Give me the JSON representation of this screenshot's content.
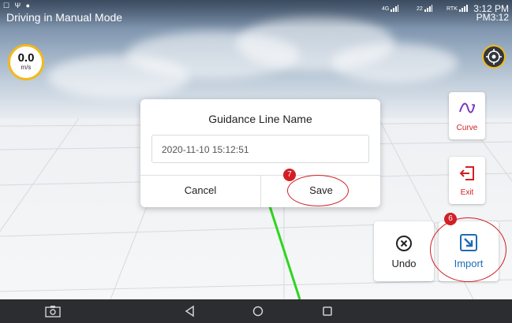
{
  "status_bar": {
    "title": "Driving in Manual Mode",
    "left_icons": "☐ Ψ ●",
    "signal_1": "4G",
    "signal_2": "22",
    "signal_3": "RTK",
    "clock_front": "3:12 PM",
    "clock_back": "PM3:12"
  },
  "speed": {
    "value": "0.0",
    "unit": "m/s"
  },
  "side_buttons": {
    "curve_label": "Curve",
    "exit_label": "Exit"
  },
  "big_buttons": {
    "undo_label": "Undo",
    "import_label": "Import"
  },
  "dialog": {
    "title": "Guidance Line Name",
    "input_value": "2020-11-10 15:12:51",
    "cancel_label": "Cancel",
    "save_label": "Save"
  },
  "annotations": {
    "badge_save": "7",
    "badge_import": "6"
  },
  "colors": {
    "accent_red": "#d21f26",
    "speed_ring": "#f1b91c",
    "import_blue": "#1d6bb5",
    "guide_line": "#2ed61e"
  },
  "nav_bar": {
    "icons": [
      "screenshot-icon",
      "back-icon",
      "home-icon",
      "recents-icon"
    ]
  }
}
